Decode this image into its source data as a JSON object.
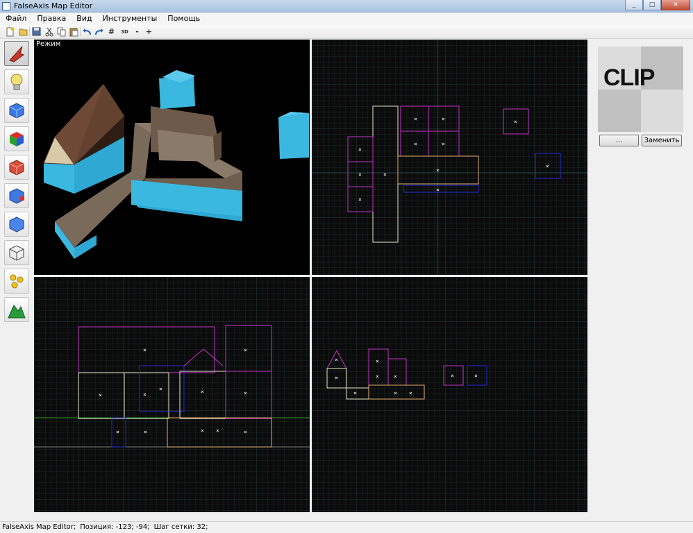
{
  "window": {
    "title": "FalseAxis Map Editor",
    "buttons": [
      "_",
      "□",
      "✕"
    ]
  },
  "menu": [
    "Файл",
    "Правка",
    "Вид",
    "Инструменты",
    "Помощь"
  ],
  "toolbar": {
    "icons": [
      "new-file-icon",
      "open-folder-icon",
      "save-icon",
      "cut-icon",
      "copy-icon",
      "paste-icon",
      "undo-icon",
      "redo-icon",
      "grid-icon",
      "grid-3d-icon",
      "grid-smaller-icon",
      "grid-larger-icon"
    ],
    "labels": {
      "grid": "#",
      "grid3d": "3D",
      "gridSmaller": "-",
      "gridLarger": "+"
    }
  },
  "tools": [
    {
      "name": "pointer-tool",
      "icon": "arrow-icon"
    },
    {
      "name": "entity-tool",
      "icon": "lightbulb-icon"
    },
    {
      "name": "brush-tool",
      "icon": "cube-icon"
    },
    {
      "name": "texture-tool",
      "icon": "colored-cube-icon"
    },
    {
      "name": "clip-tool",
      "icon": "red-cube-icon"
    },
    {
      "name": "vertex-tool",
      "icon": "blue-cube-red-corner-icon"
    },
    {
      "name": "select-brush-tool",
      "icon": "blue-cube-icon"
    },
    {
      "name": "cage-tool",
      "icon": "wire-cube-icon"
    },
    {
      "name": "group-tool",
      "icon": "spheres-icon"
    },
    {
      "name": "terrain-tool",
      "icon": "terrain-icon"
    }
  ],
  "viewport3d": {
    "label": "Режим"
  },
  "texture": {
    "name": "CLIP",
    "browse_label": "...",
    "replace_label": "Заменить"
  },
  "status": {
    "app": "FalseAxis Map Editor;",
    "position": "Позиция: -123; -94;",
    "grid": "Шаг сетки: 32;"
  },
  "colors": {
    "viewport_bg": "#0c0c0c",
    "grid_minor": "#1f2a2a",
    "grid_major": "#2c3b3b",
    "brush_magenta": "#c236c6",
    "brush_white": "#e8e8d0",
    "brush_orange": "#e0b070",
    "brush_blue": "#2a2ad8"
  }
}
